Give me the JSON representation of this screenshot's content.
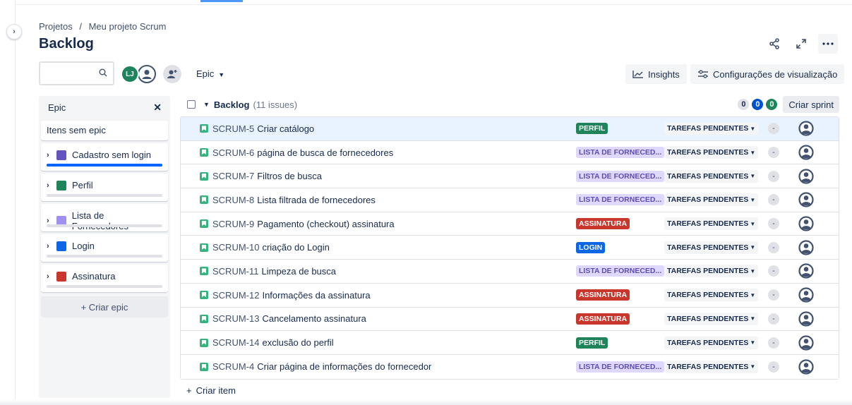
{
  "breadcrumb": {
    "projects": "Projetos",
    "separator": "/",
    "project": "Meu projeto Scrum"
  },
  "page": {
    "title": "Backlog"
  },
  "search": {
    "placeholder": ""
  },
  "avatars": {
    "initials": "LJ"
  },
  "filters": {
    "epic_label": "Epic"
  },
  "toolbar": {
    "insights_label": "Insights",
    "view_settings_label": "Configurações de visualização"
  },
  "epic_panel": {
    "title": "Epic",
    "none_label": "Itens sem epic",
    "items": [
      {
        "label": "Cadastro sem login",
        "color": "#6554c0",
        "progress": 1.0
      },
      {
        "label": "Perfil",
        "color": "#1f845a",
        "progress": 0.0
      },
      {
        "label": "Lista de Fornecedores",
        "color": "#9f8fef",
        "progress": 0.0
      },
      {
        "label": "Login",
        "color": "#0c66e4",
        "progress": 0.0
      },
      {
        "label": "Assinatura",
        "color": "#c9372c",
        "progress": 0.0
      }
    ],
    "create_label": "+ Criar epic"
  },
  "backlog": {
    "title": "Backlog",
    "count_label": "(11 issues)",
    "counters": {
      "todo": "0",
      "in_progress": "0",
      "done": "0"
    },
    "create_sprint_label": "Criar sprint",
    "create_item_label": "Criar item",
    "status_label": "TAREFAS PENDENTES",
    "estimate_label": "-",
    "issues": [
      {
        "key": "SCRUM-5",
        "summary": "Criar catálogo",
        "epic": "PERFIL",
        "epic_bg": "#1f845a",
        "epic_fg": "#ffffff"
      },
      {
        "key": "SCRUM-6",
        "summary": "página de busca de fornecedores",
        "epic": "LISTA DE FORNECED...",
        "epic_bg": "#dfd8fd",
        "epic_fg": "#5e4db2"
      },
      {
        "key": "SCRUM-7",
        "summary": "Filtros de busca",
        "epic": "LISTA DE FORNECED...",
        "epic_bg": "#dfd8fd",
        "epic_fg": "#5e4db2"
      },
      {
        "key": "SCRUM-8",
        "summary": "Lista filtrada de fornecedores",
        "epic": "LISTA DE FORNECED...",
        "epic_bg": "#dfd8fd",
        "epic_fg": "#5e4db2"
      },
      {
        "key": "SCRUM-9",
        "summary": "Pagamento (checkout) assinatura",
        "epic": "ASSINATURA",
        "epic_bg": "#c9372c",
        "epic_fg": "#ffffff"
      },
      {
        "key": "SCRUM-10",
        "summary": "criação do Login",
        "epic": "LOGIN",
        "epic_bg": "#0c66e4",
        "epic_fg": "#ffffff"
      },
      {
        "key": "SCRUM-11",
        "summary": "Limpeza de busca",
        "epic": "LISTA DE FORNECED...",
        "epic_bg": "#dfd8fd",
        "epic_fg": "#5e4db2"
      },
      {
        "key": "SCRUM-12",
        "summary": "Informações da assinatura",
        "epic": "ASSINATURA",
        "epic_bg": "#c9372c",
        "epic_fg": "#ffffff"
      },
      {
        "key": "SCRUM-13",
        "summary": "Cancelamento assinatura",
        "epic": "ASSINATURA",
        "epic_bg": "#c9372c",
        "epic_fg": "#ffffff"
      },
      {
        "key": "SCRUM-14",
        "summary": "exclusão do perfil",
        "epic": "PERFIL",
        "epic_bg": "#1f845a",
        "epic_fg": "#ffffff"
      },
      {
        "key": "SCRUM-4",
        "summary": "Criar página de informações do fornecedor",
        "epic": "LISTA DE FORNECED...",
        "epic_bg": "#dfd8fd",
        "epic_fg": "#5e4db2"
      }
    ]
  },
  "icons": {
    "expand_sidebar": "chevron-right-icon",
    "share": "share-icon",
    "fullscreen": "expand-icon",
    "more": "more-icon",
    "search": "search-icon",
    "user": "user-icon",
    "add_people": "add-people-icon",
    "insights": "chart-icon",
    "settings": "sliders-icon",
    "story": "story-icon"
  }
}
